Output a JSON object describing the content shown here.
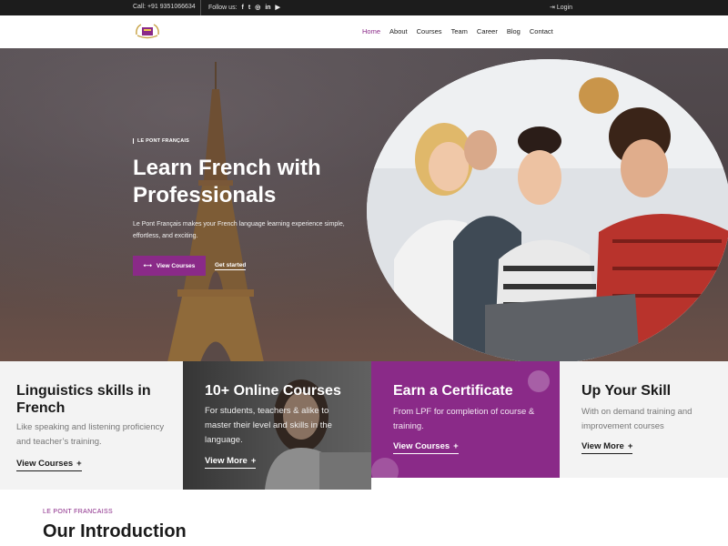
{
  "topbar": {
    "phone": "Call: +91 9351066634",
    "follow_label": "Follow us:",
    "social": [
      {
        "name": "facebook-icon",
        "glyph": "f"
      },
      {
        "name": "twitter-icon",
        "glyph": "t"
      },
      {
        "name": "instagram-icon",
        "glyph": "◎"
      },
      {
        "name": "linkedin-icon",
        "glyph": "in"
      },
      {
        "name": "youtube-icon",
        "glyph": "▶"
      }
    ],
    "login": "Login"
  },
  "nav": {
    "items": [
      {
        "label": "Home",
        "active": true
      },
      {
        "label": "About",
        "active": false
      },
      {
        "label": "Courses",
        "active": false
      },
      {
        "label": "Team",
        "active": false
      },
      {
        "label": "Career",
        "active": false
      },
      {
        "label": "Blog",
        "active": false
      },
      {
        "label": "Contact",
        "active": false
      }
    ]
  },
  "hero": {
    "tag": "LE PONT FRANÇAIS",
    "title": "Learn French with Professionals",
    "description": "Le Pont Français makes your French language learning experience simple, effortless, and exciting.",
    "primary_button": "View Courses",
    "secondary_link": "Get started"
  },
  "cards": [
    {
      "title": "Linguistics skills in French",
      "text": "Like speaking and listening proficiency and teacher’s training.",
      "link": "View Courses"
    },
    {
      "title": "10+ Online Courses",
      "text": "For students, teachers & alike to master their level and skills in the language.",
      "link": "View More"
    },
    {
      "title": "Earn a Certificate",
      "text": "From LPF for completion of course & training.",
      "link": "View Courses"
    },
    {
      "title": "Up Your Skill",
      "text": "With on demand training and improvement courses",
      "link": "View More"
    }
  ],
  "intro": {
    "tag": "LE PONT FRANCAISS",
    "title": "Our Introduction"
  },
  "colors": {
    "brand": "#8a2a88",
    "topbar": "#1c1c1c"
  }
}
